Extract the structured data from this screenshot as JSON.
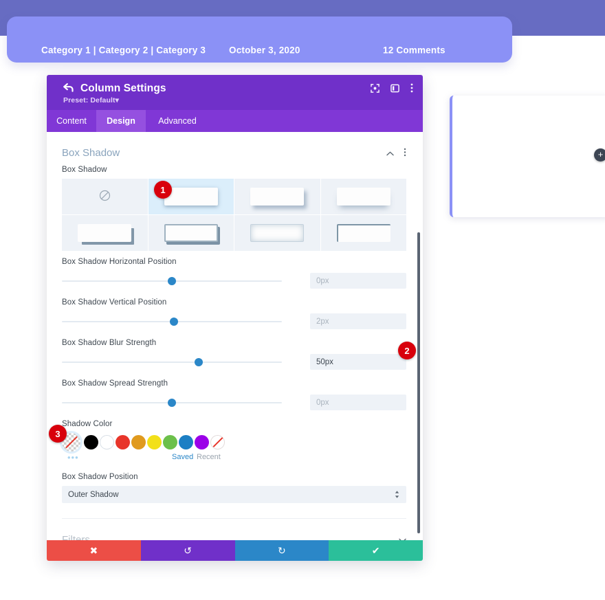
{
  "post_meta": {
    "categories": "Category 1 | Category 2 | Category 3",
    "date": "October 3, 2020",
    "comments": "12 Comments"
  },
  "side_card": {
    "add_label": "+"
  },
  "modal": {
    "back_icon": "back-arrow-icon",
    "title": "Column Settings",
    "preset": "Preset: Default",
    "preset_caret": "▾",
    "header_icons": [
      {
        "name": "expand-icon"
      },
      {
        "name": "layout-panel-icon"
      },
      {
        "name": "kebab-menu-icon"
      }
    ],
    "tabs": [
      {
        "label": "Content",
        "active": false
      },
      {
        "label": "Design",
        "active": true
      },
      {
        "label": "Advanced",
        "active": false
      }
    ],
    "sections": {
      "box_shadow": {
        "title": "Box Shadow",
        "collapse_icon": "chevron-up-icon",
        "menu_icon": "kebab-menu-icon",
        "field_label": "Box Shadow",
        "presets": [
          {
            "name": "no-shadow",
            "selected": false
          },
          {
            "name": "shadow-soft-bottom",
            "selected": true
          },
          {
            "name": "shadow-offset-right",
            "selected": false
          },
          {
            "name": "shadow-deep-bottom",
            "selected": false
          },
          {
            "name": "shadow-hard-offset",
            "selected": false
          },
          {
            "name": "shadow-outline-hard",
            "selected": false
          },
          {
            "name": "shadow-inner-glow",
            "selected": false
          },
          {
            "name": "shadow-top-left-border",
            "selected": false
          }
        ],
        "sliders": [
          {
            "label": "Box Shadow Horizontal Position",
            "value": "0px",
            "filled": false,
            "knob_pct": 50
          },
          {
            "label": "Box Shadow Vertical Position",
            "value": "2px",
            "filled": false,
            "knob_pct": 51
          },
          {
            "label": "Box Shadow Blur Strength",
            "value": "50px",
            "filled": true,
            "knob_pct": 62
          },
          {
            "label": "Box Shadow Spread Strength",
            "value": "0px",
            "filled": false,
            "knob_pct": 50
          }
        ],
        "color_label": "Shadow Color",
        "swatches": [
          {
            "name": "transparent-checker-swatch",
            "hex": "transparent",
            "kind": "first"
          },
          {
            "name": "black-swatch",
            "hex": "#000000",
            "kind": "solid"
          },
          {
            "name": "white-swatch",
            "hex": "#ffffff",
            "kind": "white"
          },
          {
            "name": "red-swatch",
            "hex": "#e8352a",
            "kind": "solid"
          },
          {
            "name": "orange-swatch",
            "hex": "#e09a1e",
            "kind": "solid"
          },
          {
            "name": "yellow-swatch",
            "hex": "#f2e019",
            "kind": "solid"
          },
          {
            "name": "green-swatch",
            "hex": "#6cc04a",
            "kind": "solid"
          },
          {
            "name": "blue-swatch",
            "hex": "#1c7fc4",
            "kind": "solid"
          },
          {
            "name": "purple-swatch",
            "hex": "#9b00e8",
            "kind": "solid"
          },
          {
            "name": "no-color-swatch",
            "hex": "#ffffff",
            "kind": "none"
          }
        ],
        "more_colors": "•••",
        "saved_label": "Saved",
        "recent_label": "Recent",
        "position_label": "Box Shadow Position",
        "position_value": "Outer Shadow",
        "position_arrows": "↕"
      },
      "filters": {
        "title": "Filters",
        "expand_icon": "chevron-down-icon"
      }
    },
    "footer": [
      {
        "name": "cancel-button",
        "icon": "✖",
        "class": "cancel"
      },
      {
        "name": "undo-button",
        "icon": "↺",
        "class": "undo"
      },
      {
        "name": "redo-button",
        "icon": "↻",
        "class": "redo"
      },
      {
        "name": "save-button",
        "icon": "✔",
        "class": "save"
      }
    ]
  },
  "badges": [
    {
      "label": "1"
    },
    {
      "label": "2"
    },
    {
      "label": "3"
    }
  ],
  "colors": {
    "strip": "#676cc2",
    "banner": "#8b91f6",
    "modal_header": "#7030c9",
    "tab_bar": "#8037d6",
    "tab_active": "#9550e0",
    "accent_blue": "#2b87c8",
    "badge_red": "#d8000c"
  }
}
